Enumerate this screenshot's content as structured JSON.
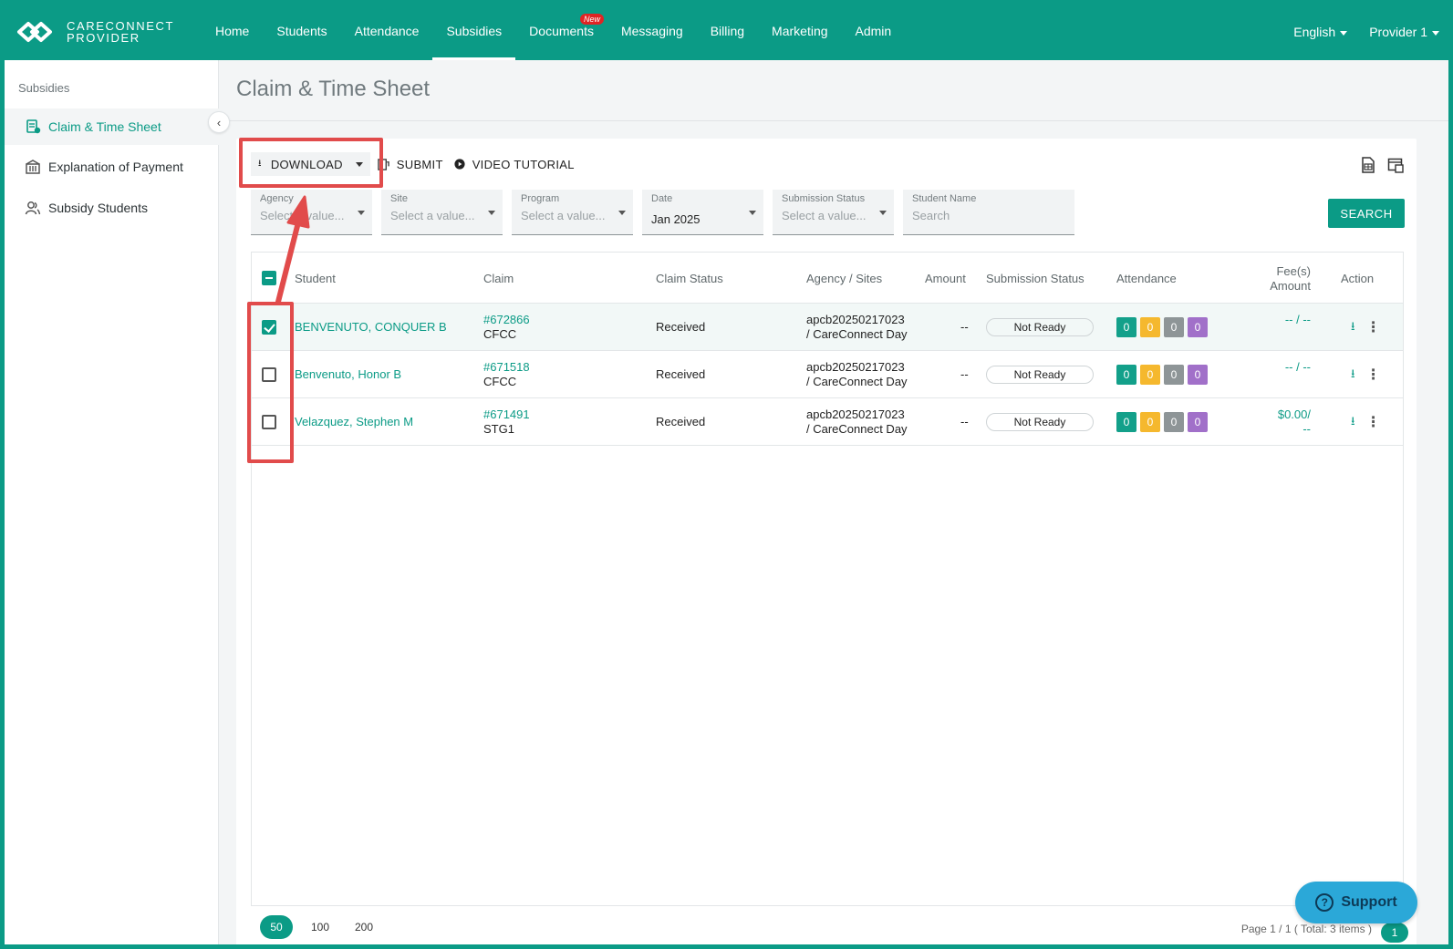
{
  "brand": {
    "line1": "CARECONNECT",
    "line2": "PROVIDER"
  },
  "nav": {
    "items": [
      "Home",
      "Students",
      "Attendance",
      "Subsidies",
      "Documents",
      "Messaging",
      "Billing",
      "Marketing",
      "Admin"
    ],
    "active": "Subsidies",
    "documents_badge": "New",
    "language": "English",
    "provider": "Provider 1"
  },
  "sidebar": {
    "title": "Subsidies",
    "items": [
      {
        "label": "Claim & Time Sheet",
        "icon": "claim-sheet-icon",
        "active": true
      },
      {
        "label": "Explanation of Payment",
        "icon": "payment-building-icon",
        "active": false
      },
      {
        "label": "Subsidy Students",
        "icon": "students-icon",
        "active": false
      }
    ]
  },
  "page": {
    "title": "Claim & Time Sheet"
  },
  "toolbar": {
    "download": "DOWNLOAD",
    "submit": "SUBMIT",
    "video": "VIDEO TUTORIAL"
  },
  "filters": {
    "agency": {
      "label": "Agency",
      "placeholder": "Select a value..."
    },
    "site": {
      "label": "Site",
      "placeholder": "Select a value..."
    },
    "program": {
      "label": "Program",
      "placeholder": "Select a value..."
    },
    "date": {
      "label": "Date",
      "value": "Jan 2025"
    },
    "submission_status": {
      "label": "Submission Status",
      "placeholder": "Select a value..."
    },
    "student_name": {
      "label": "Student Name",
      "placeholder": "Search"
    },
    "search_button": "SEARCH"
  },
  "table": {
    "headers": {
      "student": "Student",
      "claim": "Claim",
      "claim_status": "Claim Status",
      "agency_sites": "Agency / Sites",
      "amount": "Amount",
      "submission_status": "Submission Status",
      "attendance": "Attendance",
      "fees_line1": "Fee(s)",
      "fees_line2": "Amount",
      "action": "Action"
    },
    "rows": [
      {
        "checked": true,
        "student": "BENVENUTO, CONQUER B",
        "claim_no": "#672866",
        "claim_prog": "CFCC",
        "status": "Received",
        "agency": "apcb20250217023",
        "site": "/ CareConnect Day",
        "amount": "--",
        "submission": "Not Ready",
        "att": [
          "0",
          "0",
          "0",
          "0"
        ],
        "fee1": "-- / --",
        "fee2": ""
      },
      {
        "checked": false,
        "student": "Benvenuto, Honor B",
        "claim_no": "#671518",
        "claim_prog": "CFCC",
        "status": "Received",
        "agency": "apcb20250217023",
        "site": "/ CareConnect Day",
        "amount": "--",
        "submission": "Not Ready",
        "att": [
          "0",
          "0",
          "0",
          "0"
        ],
        "fee1": "-- / --",
        "fee2": ""
      },
      {
        "checked": false,
        "student": "Velazquez, Stephen M",
        "claim_no": "#671491",
        "claim_prog": "STG1",
        "status": "Received",
        "agency": "apcb20250217023",
        "site": "/ CareConnect Day",
        "amount": "--",
        "submission": "Not Ready",
        "att": [
          "0",
          "0",
          "0",
          "0"
        ],
        "fee1": "$0.00/",
        "fee2": "--"
      }
    ]
  },
  "attendance_colors": [
    "#13a08a",
    "#f5b82e",
    "#8e9597",
    "#a170c9"
  ],
  "pagination": {
    "sizes": [
      "50",
      "100",
      "200"
    ],
    "info": "Page 1 / 1 ( Total: 3 items )",
    "current": "1"
  },
  "support": "Support",
  "colors": {
    "brand": "#0b9b86",
    "annotation": "#e14b4b"
  }
}
